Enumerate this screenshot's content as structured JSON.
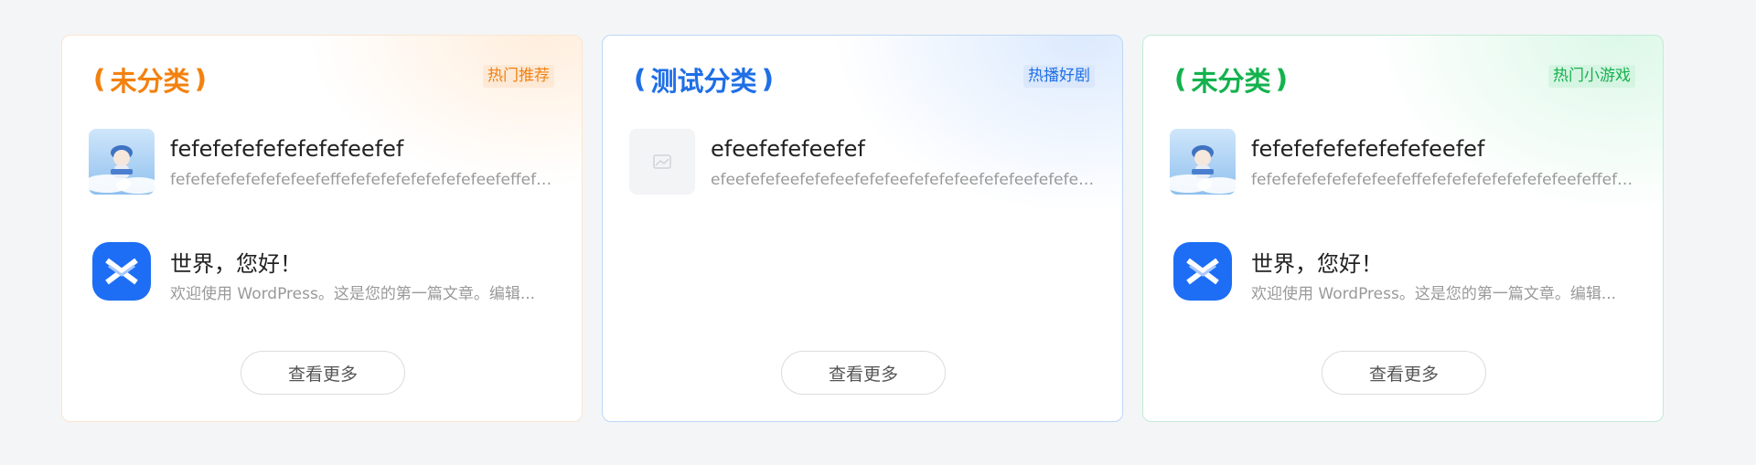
{
  "cards": [
    {
      "title": "未分类",
      "tag": "热门推荐",
      "items": [
        {
          "title": "fefefefefefefefefeefef",
          "desc": "fefefefefefefefefeefeffefefefefefefefefefeefeffefef..."
        },
        {
          "title": "世界，您好！",
          "desc": "欢迎使用 WordPress。这是您的第一篇文章。编辑..."
        }
      ],
      "more_label": "查看更多"
    },
    {
      "title": "测试分类",
      "tag": "热播好剧",
      "items": [
        {
          "title": "efeefefefeefef",
          "desc": "efeefefefeefefefeefefefeefefefefeefefefeefefefeef..."
        }
      ],
      "more_label": "查看更多"
    },
    {
      "title": "未分类",
      "tag": "热门小游戏",
      "items": [
        {
          "title": "fefefefefefefefefeefef",
          "desc": "fefefefefefefefefeefeffefefefefefefefefefeefeffefef..."
        },
        {
          "title": "世界，您好！",
          "desc": "欢迎使用 WordPress。这是您的第一篇文章。编辑..."
        }
      ],
      "more_label": "查看更多"
    }
  ],
  "colors": {
    "orange": "#f3810f",
    "blue": "#1f6fe6",
    "green": "#13b24d",
    "wp_blue": "#1d6ef5"
  },
  "icons": {
    "mascot": "cartoon-character-thumbnail",
    "wp_logo": "blue-x-app-logo",
    "placeholder": "image-placeholder-icon",
    "laurel": "laurel-wreath-icon"
  }
}
